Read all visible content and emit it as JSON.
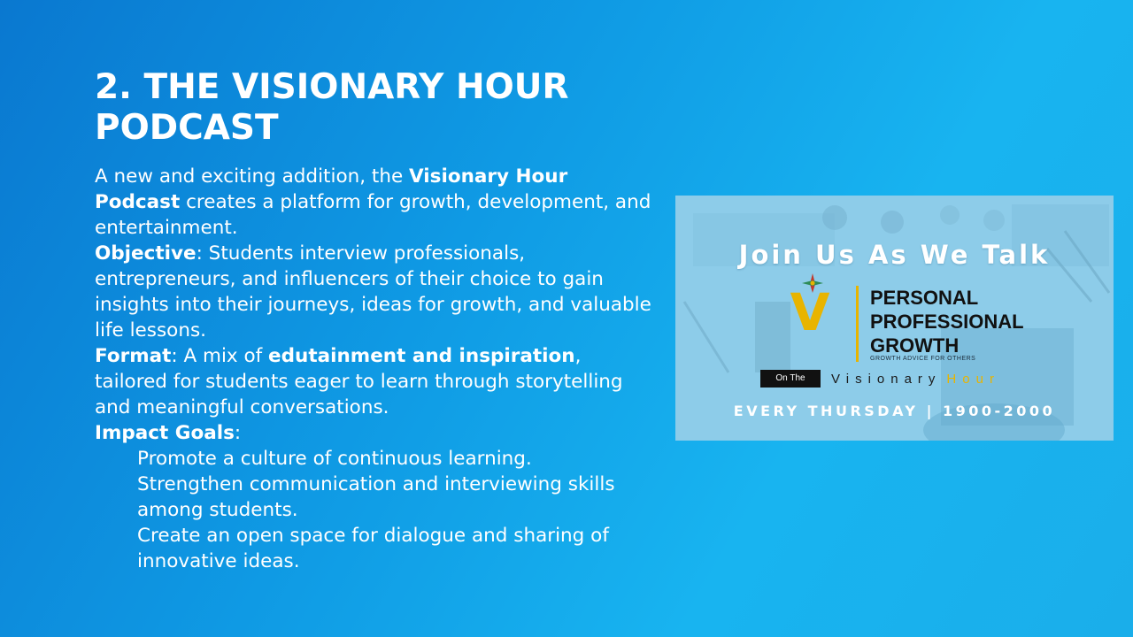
{
  "title": "2. THE VISIONARY HOUR PODCAST",
  "intro": {
    "pre": "A new and exciting addition, the ",
    "bold": "Visionary Hour Podcast",
    "post": " creates a platform for growth, development, and entertainment."
  },
  "objective": {
    "label": "Objective",
    "text": ": Students interview professionals, entrepreneurs, and influencers of their choice to gain insights into their journeys, ideas for growth, and valuable life lessons."
  },
  "format": {
    "label": "Format",
    "pre": ": A mix of ",
    "bold": "edutainment and inspiration",
    "post": ", tailored for students eager to learn through storytelling and meaningful conversations."
  },
  "impact": {
    "label": "Impact Goals",
    "colon": ":",
    "goals": [
      "Promote a culture of continuous learning.",
      "Strengthen communication and interviewing skills among students.",
      "Create an open space for dialogue and sharing of innovative ideas."
    ]
  },
  "promo": {
    "join": "Join Us As We Talk",
    "line1": "PERSONAL",
    "line2": "PROFESSIONAL",
    "line3": "GROWTH",
    "tagline": "GROWTH ADVICE FOR OTHERS",
    "on_the": "On The",
    "visionary": "Visionary",
    "hour": "Hour",
    "schedule": "EVERY THURSDAY | 1900-2000",
    "logo_letter": "V",
    "accent": "#e8b400"
  }
}
